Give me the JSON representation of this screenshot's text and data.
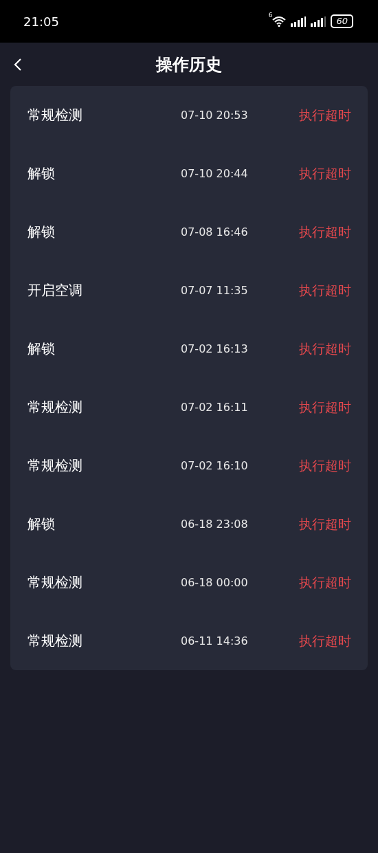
{
  "status_bar": {
    "time": "21:05",
    "wifi_label": "6",
    "battery": "60"
  },
  "header": {
    "title": "操作历史"
  },
  "history": [
    {
      "operation": "常规检测",
      "time": "07-10 20:53",
      "status": "执行超时"
    },
    {
      "operation": "解锁",
      "time": "07-10 20:44",
      "status": "执行超时"
    },
    {
      "operation": "解锁",
      "time": "07-08 16:46",
      "status": "执行超时"
    },
    {
      "operation": "开启空调",
      "time": "07-07 11:35",
      "status": "执行超时"
    },
    {
      "operation": "解锁",
      "time": "07-02 16:13",
      "status": "执行超时"
    },
    {
      "operation": "常规检测",
      "time": "07-02 16:11",
      "status": "执行超时"
    },
    {
      "operation": "常规检测",
      "time": "07-02 16:10",
      "status": "执行超时"
    },
    {
      "operation": "解锁",
      "time": "06-18 23:08",
      "status": "执行超时"
    },
    {
      "operation": "常规检测",
      "time": "06-18 00:00",
      "status": "执行超时"
    },
    {
      "operation": "常规检测",
      "time": "06-11 14:36",
      "status": "执行超时"
    }
  ]
}
